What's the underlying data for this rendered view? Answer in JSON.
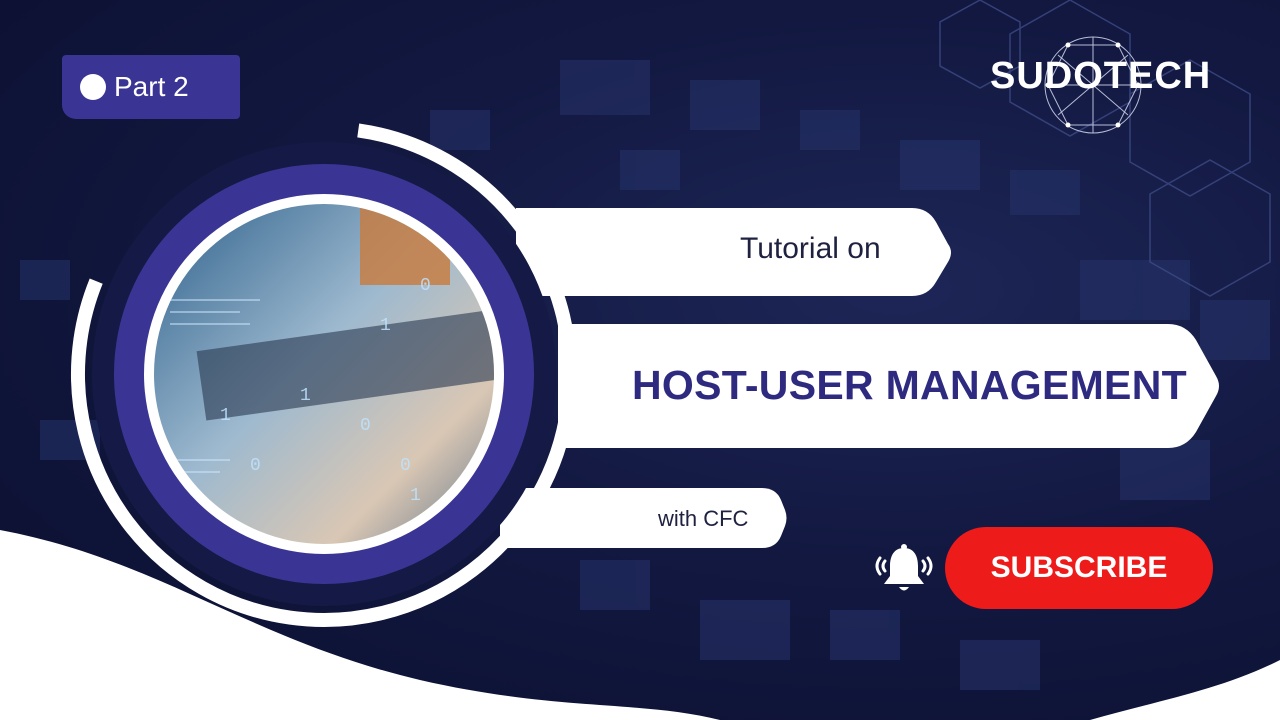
{
  "badge": {
    "label": "Part 2"
  },
  "brand": {
    "name": "SUDOTECH"
  },
  "headline": {
    "intro": "Tutorial on",
    "title": "HOST-USER MANAGEMENT",
    "suffix": "with CFC"
  },
  "cta": {
    "subscribe_label": "SUBSCRIBE",
    "bell_icon": "bell-ringing-icon"
  },
  "colors": {
    "background": "#121840",
    "accent_purple": "#3a3594",
    "title_color": "#2e2a80",
    "subscribe_red": "#ee1b1b"
  }
}
